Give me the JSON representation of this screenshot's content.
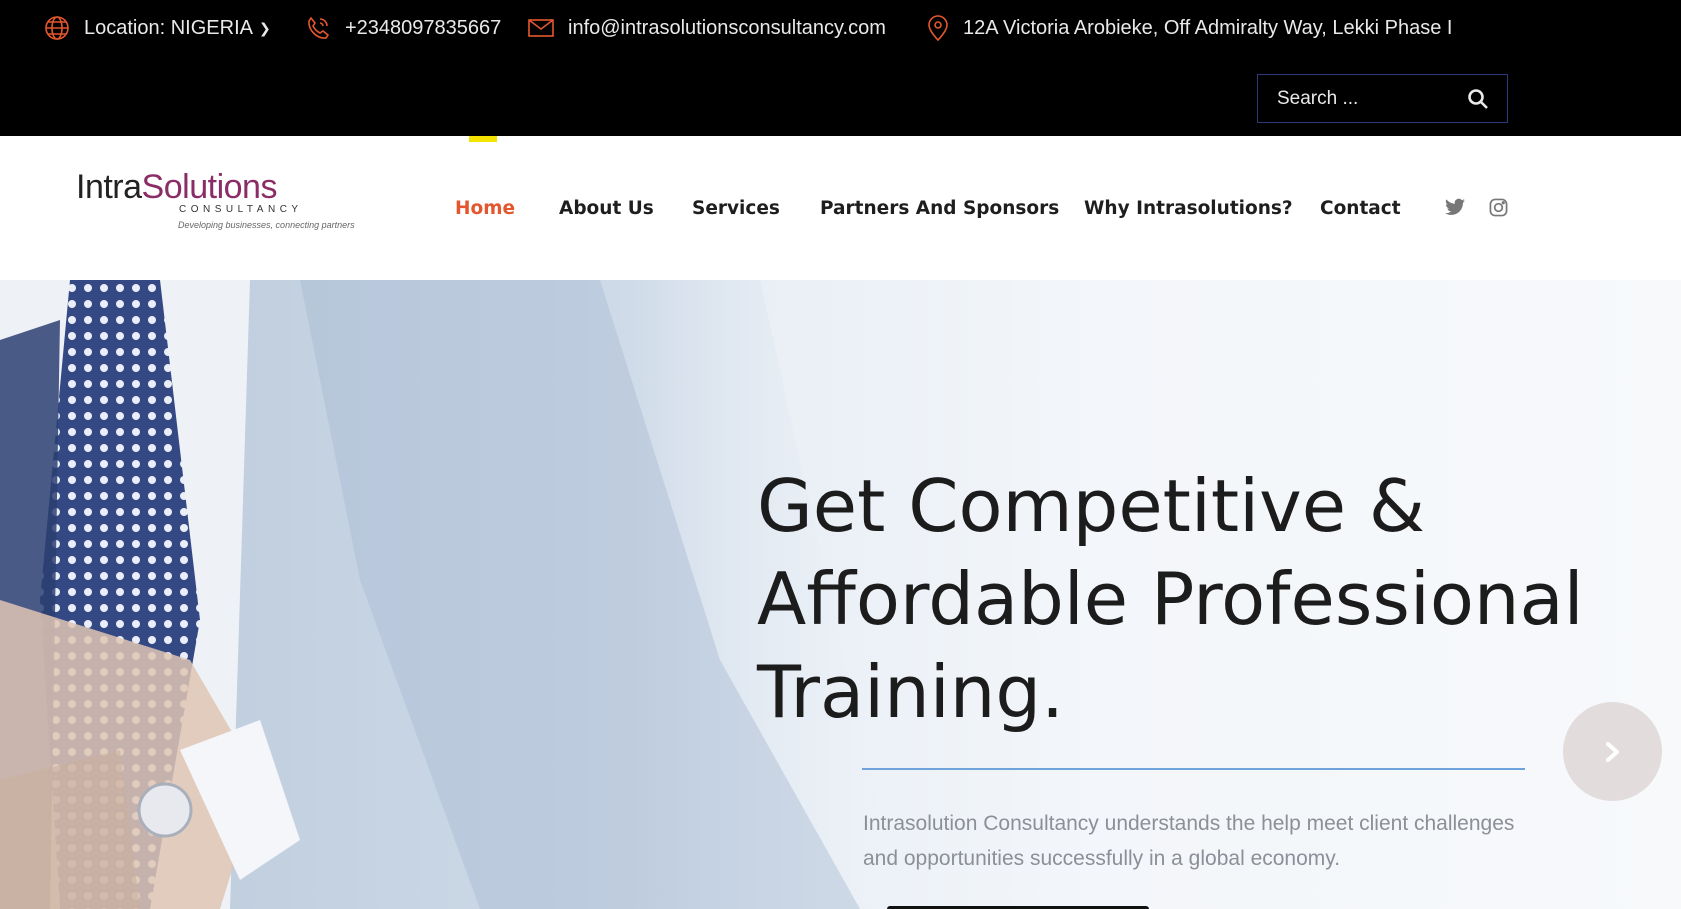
{
  "topbar": {
    "location_label": "Location: NIGERIA",
    "phone": "+2348097835667",
    "email": "info@intrasolutionsconsultancy.com",
    "address": "12A Victoria Arobieke, Off Admiralty Way, Lekki Phase I",
    "search_placeholder": "Search ..."
  },
  "brand": {
    "name_part1": "Intra",
    "name_part2": "S",
    "name_part3": "lutions",
    "subtitle": "CONSULTANCY",
    "tagline": "Developing businesses, connecting partners"
  },
  "nav": {
    "items": [
      {
        "label": "Home",
        "active": true
      },
      {
        "label": "About Us"
      },
      {
        "label": "Services"
      },
      {
        "label": "Partners And Sponsors"
      },
      {
        "label": "Why Intrasolutions?"
      },
      {
        "label": "Contact"
      }
    ]
  },
  "social": {
    "icons": [
      "twitter-icon",
      "instagram-icon"
    ]
  },
  "hero": {
    "headline_lines": [
      "Get Competitive &",
      "Affordable Professional",
      "Training."
    ],
    "description": "Intrasolution Consultancy understands the help meet client challenges and opportunities successfully in a global economy."
  },
  "colors": {
    "accent": "#e4572e",
    "topbar_bg": "#000000",
    "nav_accent": "#f5e400",
    "divider": "#6fa3db"
  }
}
